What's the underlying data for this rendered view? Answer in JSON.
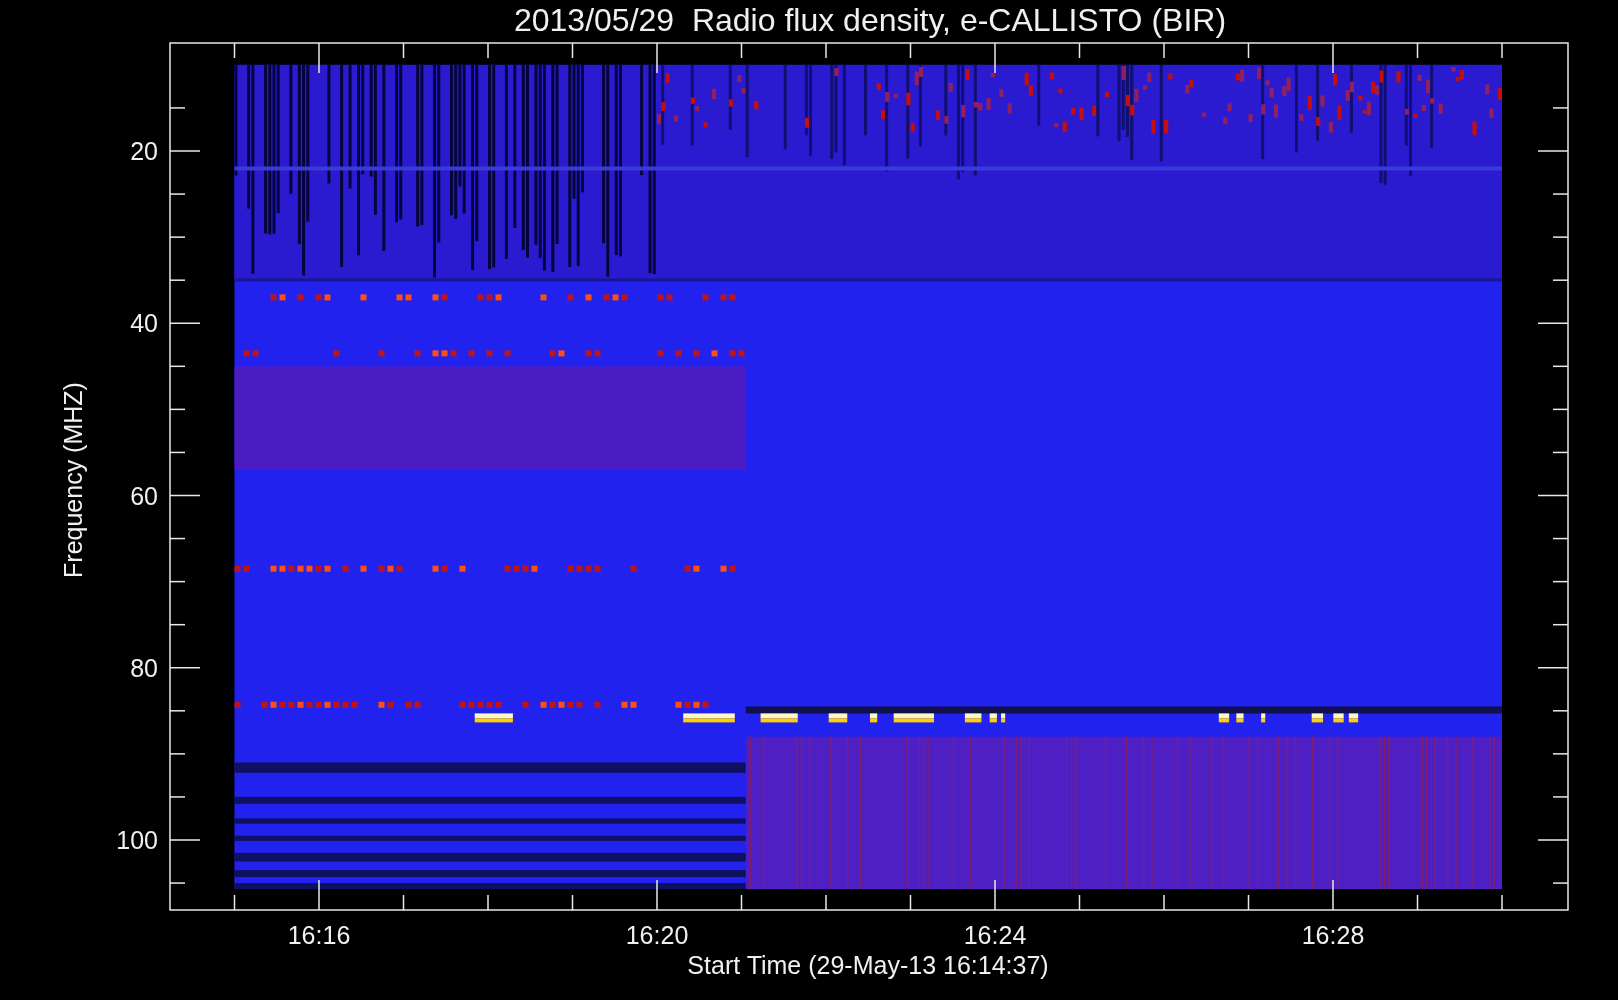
{
  "title": "2013/05/29  Radio flux density, e-CALLISTO (BIR)",
  "y_axis": {
    "label": "Frequency (MHZ)",
    "ticks": [
      "20",
      "40",
      "60",
      "80",
      "100"
    ]
  },
  "x_axis": {
    "label": "Start Time (29-May-13 16:14:37)",
    "ticks": [
      "16:16",
      "16:20",
      "16:24",
      "16:28"
    ]
  }
}
